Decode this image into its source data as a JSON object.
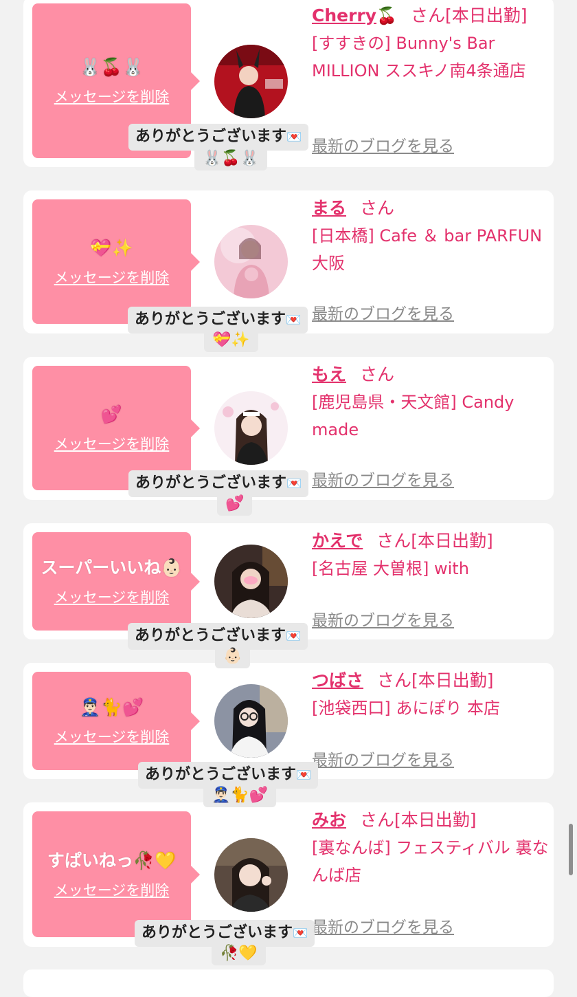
{
  "delete_label": "メッセージを削除",
  "blog_label": "最新のブログを見る",
  "thanks_label": "ありがとうございます",
  "icons": {
    "envelope": "love-letter-icon"
  },
  "colors": {
    "accent": "#e3316c",
    "bubble": "#fe8fa5",
    "background": "#f2f2f2"
  },
  "cards": [
    {
      "message": "🐰🍒🐰",
      "name": "Cherry",
      "name_emoji": "🍒",
      "suffix": "さん[本日出勤]",
      "shop": "[すすきの] Bunny's Bar MILLION ススキノ南4条通店",
      "reply_emoji": "🐰🍒🐰"
    },
    {
      "message": "💝✨",
      "name": "まる",
      "name_emoji": "",
      "suffix": "さん",
      "shop": "[日本橋] Cafe ＆ bar PARFUN 大阪",
      "reply_emoji": "💝✨"
    },
    {
      "message": "💕",
      "name": "もえ",
      "name_emoji": "",
      "suffix": "さん",
      "shop": "[鹿児島県・天文館] Candy made",
      "reply_emoji": "💕"
    },
    {
      "message": "スーパーいいね👶🏻",
      "name": "かえで",
      "name_emoji": "",
      "suffix": "さん[本日出勤]",
      "shop": "[名古屋 大曽根] with",
      "reply_emoji": "👶🏻"
    },
    {
      "message": "👮🏻‍♂️🐈💕",
      "name": "つばさ",
      "name_emoji": "",
      "suffix": "さん[本日出勤]",
      "shop": "[池袋西口] あにぽり 本店",
      "reply_emoji": "👮🏻‍♂️🐈💕"
    },
    {
      "message": "すぱいねっ🥀💛",
      "name": "みお",
      "name_emoji": "",
      "suffix": "さん[本日出勤]",
      "shop": "[裏なんば] フェスティバル 裏なんば店",
      "reply_emoji": "🥀💛"
    }
  ]
}
